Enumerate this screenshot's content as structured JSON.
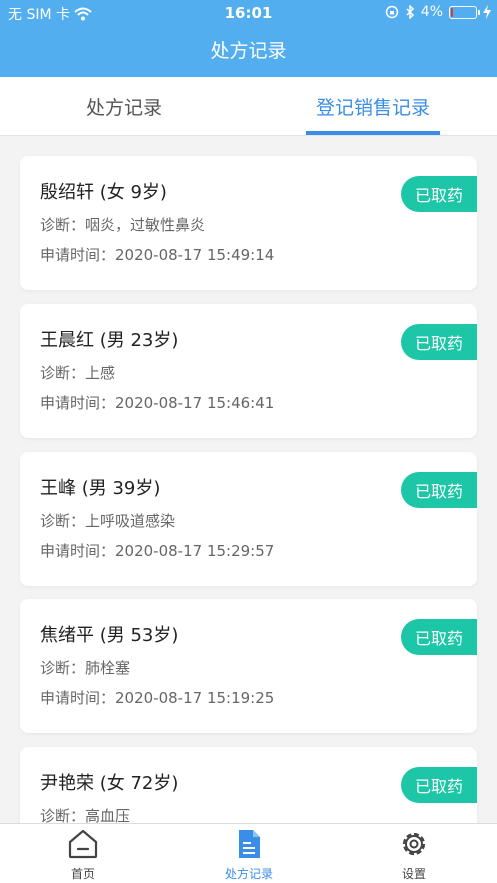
{
  "status_bar": {
    "carrier": "无 SIM 卡",
    "time": "16:01",
    "battery": "4%",
    "battery_level": 0.04
  },
  "header": {
    "title": "处方记录"
  },
  "tabs": [
    {
      "label": "处方记录"
    },
    {
      "label": "登记销售记录"
    }
  ],
  "records": [
    {
      "name": "殷绍轩 (女 9岁)",
      "diagnosis": "诊断：咽炎，过敏性鼻炎",
      "time": "申请时间：2020-08-17 15:49:14",
      "status": "已取药"
    },
    {
      "name": "王晨红 (男 23岁)",
      "diagnosis": "诊断：上感",
      "time": "申请时间：2020-08-17 15:46:41",
      "status": "已取药"
    },
    {
      "name": "王峰 (男 39岁)",
      "diagnosis": "诊断：上呼吸道感染",
      "time": "申请时间：2020-08-17 15:29:57",
      "status": "已取药"
    },
    {
      "name": "焦绪平 (男 53岁)",
      "diagnosis": "诊断：肺栓塞",
      "time": "申请时间：2020-08-17 15:19:25",
      "status": "已取药"
    },
    {
      "name": "尹艳荣 (女 72岁)",
      "diagnosis": "诊断：高血压",
      "time": "",
      "status": "已取药"
    }
  ],
  "bottom_nav": [
    {
      "label": "首页",
      "icon": "home-icon"
    },
    {
      "label": "处方记录",
      "icon": "document-icon"
    },
    {
      "label": "设置",
      "icon": "gear-icon"
    }
  ],
  "colors": {
    "header": "#53aef0",
    "accent": "#3a8ee6",
    "badge": "#1cc6a7"
  }
}
